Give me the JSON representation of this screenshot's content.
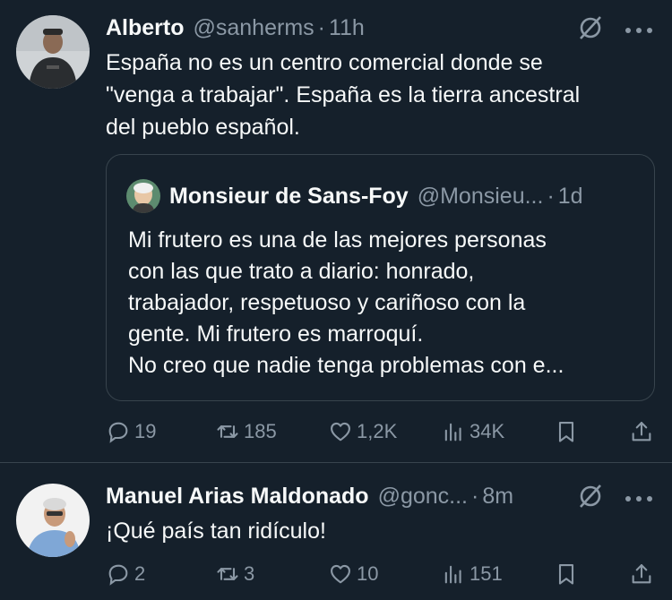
{
  "tweets": [
    {
      "name": "Alberto",
      "handle": "@sanherms",
      "dot": "·",
      "time": "11h",
      "text_lines": [
        "España no es un centro comercial donde se",
        "\"venga a trabajar\". España es la tierra ancestral",
        "del pueblo español."
      ],
      "quote": {
        "name": "Monsieur de Sans-Foy",
        "handle": "@Monsieu...",
        "dot": "·",
        "time": "1d",
        "text_lines": [
          "Mi frutero es una de las mejores personas",
          "con las que trato a diario: honrado,",
          "trabajador, respetuoso y cariñoso con la",
          "gente. Mi frutero es marroquí.",
          "No creo que nadie tenga problemas con e..."
        ]
      },
      "actions": {
        "replies": "19",
        "retweets": "185",
        "likes": "1,2K",
        "views": "34K"
      }
    },
    {
      "name": "Manuel Arias Maldonado",
      "handle": "@gonc...",
      "dot": "·",
      "time": "8m",
      "text_lines": [
        "¡Qué país tan ridículo!"
      ],
      "actions": {
        "replies": "2",
        "retweets": "3",
        "likes": "10",
        "views": "151"
      }
    }
  ],
  "icons": {
    "grok": "grok-icon",
    "more": "more-icon",
    "reply": "reply-icon",
    "retweet": "retweet-icon",
    "like": "heart-icon",
    "views": "views-icon",
    "bookmark": "bookmark-icon",
    "share": "share-icon"
  },
  "colors": {
    "background": "#15202b",
    "text": "#f7f9f9",
    "secondary": "#8b98a5",
    "border": "#38444d"
  }
}
